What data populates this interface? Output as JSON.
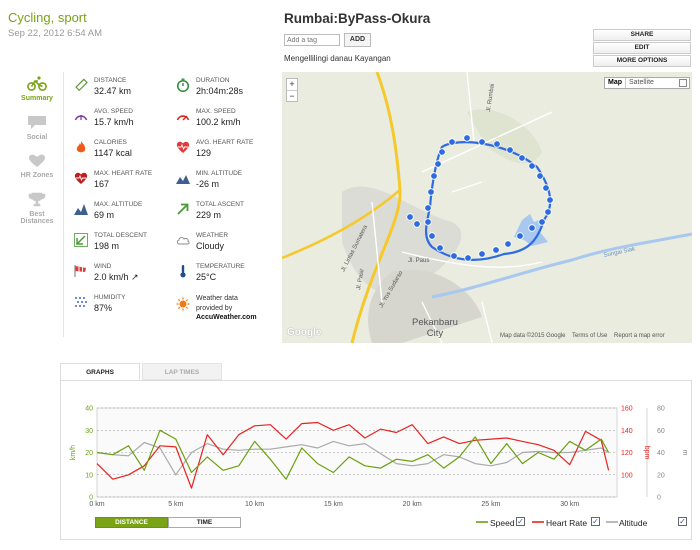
{
  "activity": {
    "type": "Cycling, sport",
    "date": "Sep 22, 2012 6:54 AM"
  },
  "route": {
    "title": "Rumbai:ByPass-Okura",
    "tag_placeholder": "Add a tag",
    "add_label": "ADD",
    "description": "Mengellilingi danau Kayangan"
  },
  "actions": {
    "share": "SHARE",
    "edit": "EDIT",
    "more": "MORE OPTIONS"
  },
  "nav": [
    {
      "label": "Summary",
      "icon": "bike-icon"
    },
    {
      "label": "Social",
      "icon": "comment-icon"
    },
    {
      "label": "HR Zones",
      "icon": "heart-icon"
    },
    {
      "label": "Best Distances",
      "icon": "trophy-icon"
    }
  ],
  "stats": [
    {
      "label": "DISTANCE",
      "value": "32.47 km",
      "icon": "ruler-icon"
    },
    {
      "label": "DURATION",
      "value": "2h:04m:28s",
      "icon": "stopwatch-icon"
    },
    {
      "label": "AVG. SPEED",
      "value": "15.7 km/h",
      "icon": "speedometer-icon"
    },
    {
      "label": "MAX. SPEED",
      "value": "100.2 km/h",
      "icon": "speedometer-max-icon"
    },
    {
      "label": "CALORIES",
      "value": "1147 kcal",
      "icon": "flame-icon"
    },
    {
      "label": "AVG. HEART RATE",
      "value": "129",
      "icon": "heart-pulse-icon"
    },
    {
      "label": "MAX. HEART RATE",
      "value": "167",
      "icon": "heart-pulse-max-icon"
    },
    {
      "label": "MIN. ALTITUDE",
      "value": "-26 m",
      "icon": "mountain-min-icon"
    },
    {
      "label": "MAX. ALTITUDE",
      "value": "69 m",
      "icon": "mountain-max-icon"
    },
    {
      "label": "TOTAL ASCENT",
      "value": "229 m",
      "icon": "arrow-up-right-icon"
    },
    {
      "label": "TOTAL DESCENT",
      "value": "198 m",
      "icon": "arrow-down-left-icon"
    },
    {
      "label": "WEATHER",
      "value": "Cloudy",
      "icon": "cloud-icon"
    },
    {
      "label": "WIND",
      "value": "2.0 km/h ↗",
      "icon": "windsock-icon"
    },
    {
      "label": "TEMPERATURE",
      "value": "25°C",
      "icon": "thermometer-icon"
    },
    {
      "label": "HUMIDITY",
      "value": "87%",
      "icon": "humidity-icon"
    }
  ],
  "weather_credit": {
    "line1": "Weather data",
    "line2": "provided by",
    "line3": "AccuWeather.com"
  },
  "map": {
    "zoom_in": "+",
    "zoom_out": "−",
    "type_map": "Map",
    "type_satellite": "Satellite",
    "attribution": "Map data ©2015 Google",
    "terms": "Terms of Use",
    "report": "Report a map error",
    "city_line1": "Pekanbaru",
    "city_line2": "City",
    "logo": "Google",
    "road_labels": [
      "Jl. Lintas Sumatera",
      "Jl. Rumbai",
      "Jl. Pasir",
      "Jl. Paus",
      "Jl. Yos Sudarso",
      "Sungai Siak"
    ],
    "route_color": "#2f6be0"
  },
  "tabs": {
    "graphs": "GRAPHS",
    "lap_times": "LAP TIMES"
  },
  "toggles": {
    "distance": "DISTANCE",
    "time": "TIME"
  },
  "legend": [
    {
      "name": "Speed",
      "color": "#6aa10f"
    },
    {
      "name": "Heart Rate",
      "color": "#e8231f"
    },
    {
      "name": "Altitude",
      "color": "#aaaaaa"
    }
  ],
  "chart_data": {
    "type": "line",
    "x": [
      0,
      1,
      2,
      3,
      4,
      5,
      6,
      7,
      8,
      9,
      10,
      11,
      12,
      13,
      14,
      15,
      16,
      17,
      18,
      19,
      20,
      21,
      22,
      23,
      24,
      25,
      26,
      27,
      28,
      29,
      30,
      31,
      32,
      32.47
    ],
    "xlabel": "",
    "x_ticks": [
      "0 km",
      "5 km",
      "10 km",
      "15 km",
      "20 km",
      "25 km",
      "30 km"
    ],
    "series": [
      {
        "name": "Speed",
        "axis": "left",
        "color": "#6aa10f",
        "values": [
          20,
          19,
          23,
          12,
          30,
          26,
          11,
          18,
          12,
          14,
          25,
          17,
          8,
          22,
          15,
          11,
          18,
          14,
          13,
          17,
          16,
          19,
          13,
          18,
          27,
          15,
          24,
          15,
          20,
          17,
          25,
          21,
          26,
          20
        ]
      },
      {
        "name": "Heart Rate",
        "axis": "right",
        "color": "#e8231f",
        "values": [
          110,
          96,
          100,
          108,
          126,
          125,
          88,
          136,
          118,
          136,
          144,
          145,
          132,
          146,
          147,
          140,
          145,
          133,
          141,
          138,
          145,
          128,
          134,
          128,
          131,
          132,
          133,
          130,
          127,
          122,
          109,
          139,
          131,
          104
        ]
      },
      {
        "name": "Altitude",
        "axis": "far-right",
        "color": "#aaaaaa",
        "values": [
          40,
          38,
          37,
          49,
          44,
          20,
          40,
          48,
          43,
          42,
          43,
          43,
          45,
          47,
          44,
          50,
          46,
          48,
          39,
          30,
          28,
          30,
          38,
          36,
          30,
          28,
          31,
          40,
          41,
          40,
          40,
          42,
          44,
          40
        ]
      }
    ],
    "y_left": {
      "label": "km/h",
      "ticks": [
        0,
        10,
        20,
        30,
        40
      ],
      "range": [
        0,
        40
      ]
    },
    "y_right": {
      "label": "bpm",
      "ticks": [
        100,
        120,
        140,
        160
      ],
      "range": [
        80,
        160
      ]
    },
    "y_far_right": {
      "label": "m",
      "ticks": [
        0,
        20,
        40,
        60,
        80
      ],
      "range": [
        0,
        80
      ]
    },
    "grid": true,
    "legend": "bottom-right"
  }
}
